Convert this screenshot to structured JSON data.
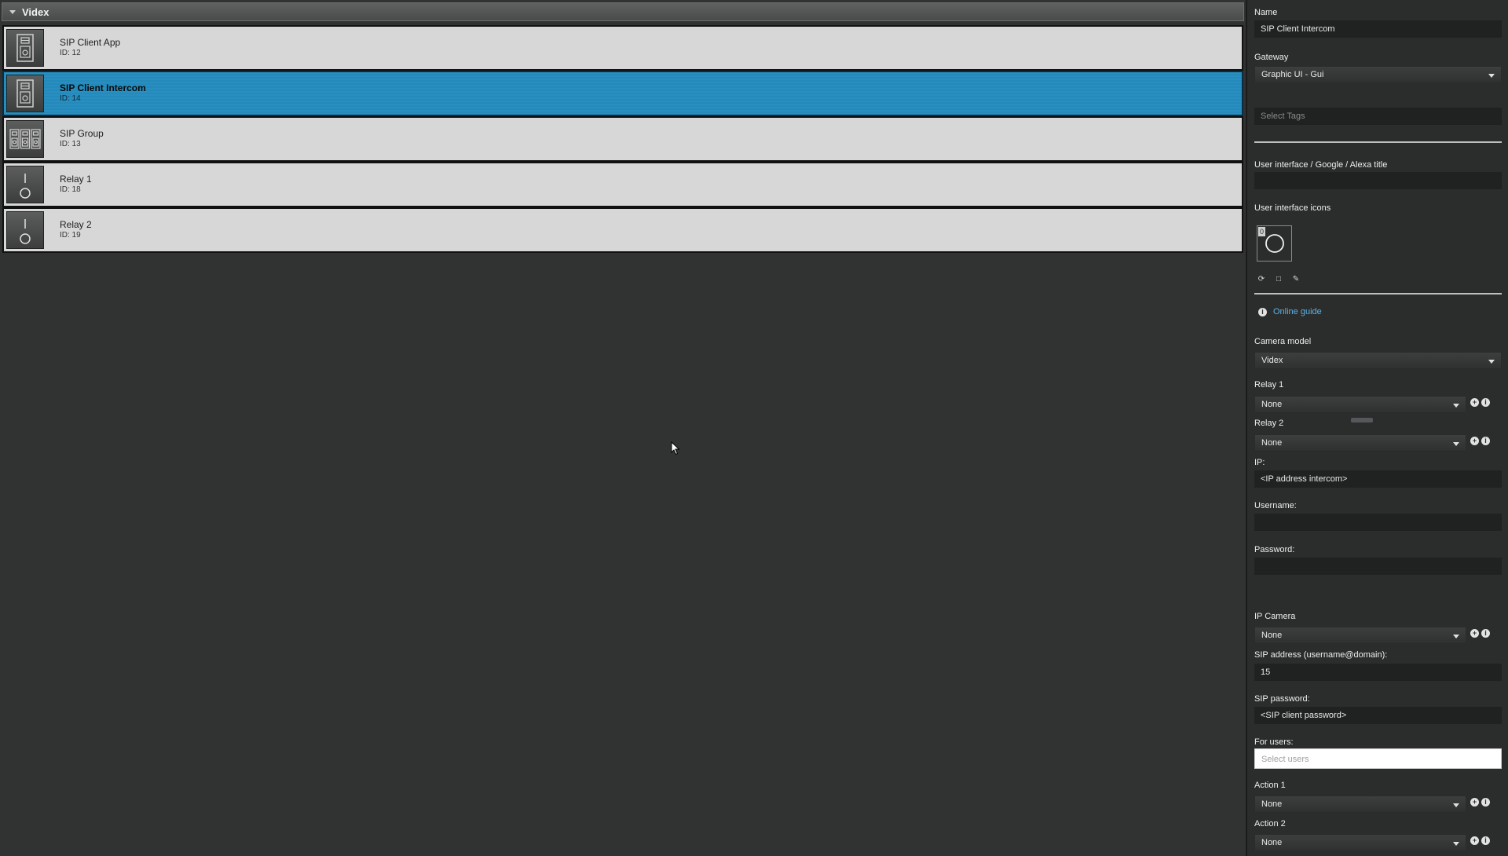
{
  "group": {
    "title": "Videx"
  },
  "devices": [
    {
      "name": "SIP Client App",
      "id": "ID: 12",
      "icon": "intercom-icon"
    },
    {
      "name": "SIP Client Intercom",
      "id": "ID: 14",
      "icon": "intercom-icon",
      "selected": true
    },
    {
      "name": "SIP Group",
      "id": "ID: 13",
      "icon": "group-icon"
    },
    {
      "name": "Relay 1",
      "id": "ID: 18",
      "icon": "relay-icon"
    },
    {
      "name": "Relay 2",
      "id": "ID: 19",
      "icon": "relay-icon"
    }
  ],
  "panel": {
    "name_label": "Name",
    "name_value": "SIP Client Intercom",
    "gateway_label": "Gateway",
    "gateway_value": "Graphic UI - Gui",
    "tags_placeholder": "Select Tags",
    "ui_title_label": "User interface / Google / Alexa title",
    "ui_title_value": "",
    "ui_icons_label": "User interface icons",
    "icon_tag": "0",
    "online_guide": "Online guide",
    "camera_model_label": "Camera model",
    "camera_model_value": "Videx",
    "relay1_label": "Relay 1",
    "relay1_value": "None",
    "relay2_label": "Relay 2",
    "relay2_value": "None",
    "ip_label": "IP:",
    "ip_value": "<IP address intercom>",
    "username_label": "Username:",
    "username_value": "",
    "password_label": "Password:",
    "password_value": "",
    "ip_camera_label": "IP Camera",
    "ip_camera_value": "None",
    "sip_address_label": "SIP address (username@domain):",
    "sip_address_value": "15",
    "sip_password_label": "SIP password:",
    "sip_password_value": "<SIP client password>",
    "for_users_label": "For users:",
    "for_users_placeholder": "Select users",
    "action1_label": "Action 1",
    "action1_value": "None",
    "action2_label": "Action 2",
    "action2_value": "None"
  },
  "colors": {
    "background": "#313332",
    "panel": "#2b2d2c",
    "row": "#d7d7d7",
    "selected_row": "#2a8ec0",
    "link": "#59b3e8"
  }
}
